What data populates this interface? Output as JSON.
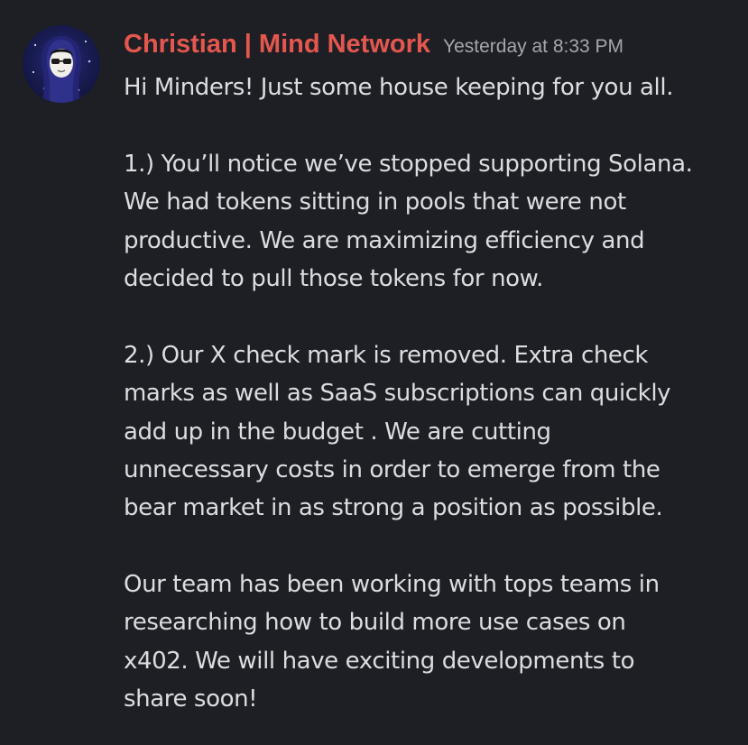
{
  "message": {
    "author": "Christian | Mind Network",
    "timestamp": "Yesterday at 8:33 PM",
    "author_color": "#e4574f",
    "avatar_icon": "hooded-figure-with-sunglasses-avatar",
    "lines": [
      "Hi Minders! Just some house keeping for you all.",
      "",
      "1.) You’ll notice we’ve stopped supporting Solana.",
      "We had tokens sitting in pools that were not",
      "productive. We are maximizing efficiency and",
      "decided to pull those tokens for now.",
      "",
      "2.) Our X check mark is removed. Extra check",
      "marks as well as SaaS subscriptions can quickly",
      "add up in the budget . We are cutting",
      "unnecessary costs in order to emerge from the",
      "bear market in as strong a position as possible.",
      "",
      "Our team has been working with tops teams in",
      "researching how to build more use cases on",
      "x402. We will have exciting developments to",
      "share soon!"
    ]
  },
  "colors": {
    "background": "#1e1f24",
    "text": "#dcdde1",
    "timestamp": "#a3a6ae"
  }
}
